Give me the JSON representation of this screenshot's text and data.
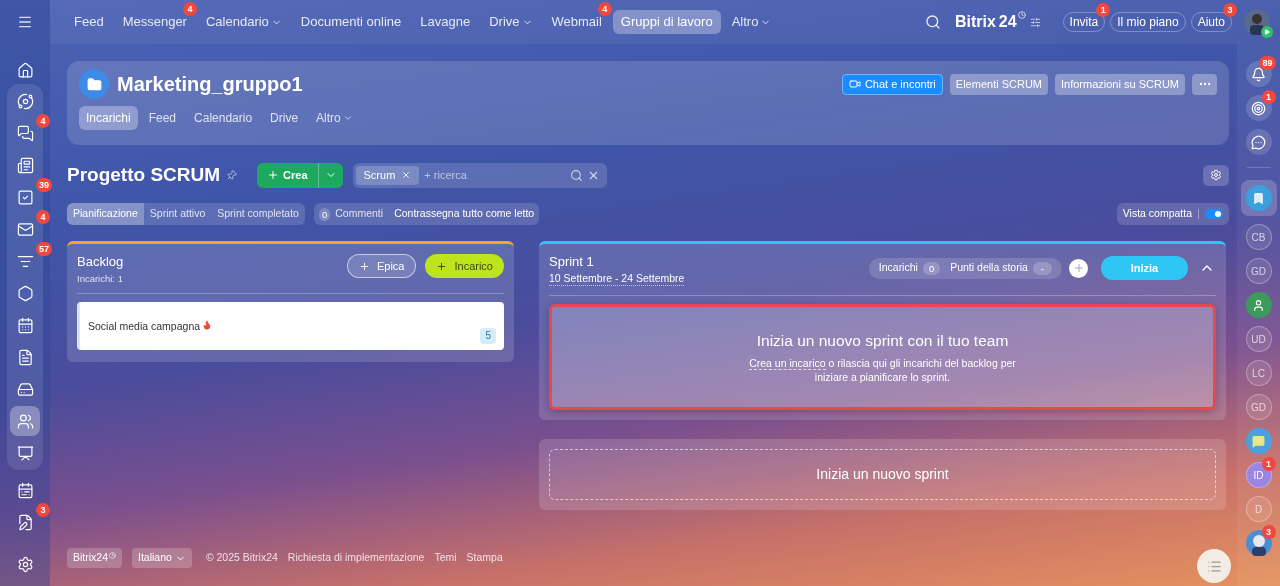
{
  "top_nav": {
    "items": [
      {
        "label": "Feed",
        "dropdown": false,
        "selected": false
      },
      {
        "label": "Messenger",
        "badge": "4",
        "dropdown": false,
        "selected": false
      },
      {
        "label": "Calendario",
        "dropdown": true,
        "selected": false
      },
      {
        "label": "Documenti online",
        "dropdown": false,
        "selected": false
      },
      {
        "label": "Lavagne",
        "dropdown": false,
        "selected": false
      },
      {
        "label": "Drive",
        "dropdown": true,
        "selected": false
      },
      {
        "label": "Webmail",
        "badge": "4",
        "dropdown": false,
        "selected": false
      },
      {
        "label": "Gruppi di lavoro",
        "dropdown": false,
        "selected": true
      },
      {
        "label": "Altro",
        "dropdown": true,
        "selected": false
      }
    ],
    "logo": "Bitrix",
    "logo_number": "24",
    "buttons": [
      {
        "label": "Invita",
        "badge": "1"
      },
      {
        "label": "Il mio piano"
      },
      {
        "label": "Aiuto",
        "badge": "3"
      }
    ]
  },
  "left_sidebar": {
    "items": [
      {
        "selected": false
      },
      {
        "selected": false
      },
      {
        "badge": "4",
        "selected": false
      },
      {
        "selected": false
      },
      {
        "badge": "39",
        "selected": false
      },
      {
        "badge": "4",
        "selected": false
      },
      {
        "badge": "57",
        "selected": false
      },
      {
        "selected": false
      },
      {
        "selected": false
      },
      {
        "selected": false
      },
      {
        "selected": false
      },
      {
        "selected": true
      },
      {
        "selected": false
      },
      {
        "selected": false
      },
      {
        "badge": "3",
        "selected": false
      },
      {
        "selected": false
      }
    ]
  },
  "right_sidebar": {
    "items": [
      {
        "kind": "bell",
        "badge": "89",
        "selected": false
      },
      {
        "kind": "target",
        "badge": "1",
        "selected": false
      },
      {
        "kind": "chat",
        "selected": false
      },
      {
        "kind": "bookmark",
        "selected": true
      },
      {
        "kind": "initials",
        "text": "CB",
        "selected": false
      },
      {
        "kind": "initials",
        "text": "GD",
        "selected": false
      },
      {
        "kind": "card",
        "selected": false
      },
      {
        "kind": "initials",
        "text": "UD",
        "selected": false
      },
      {
        "kind": "initials",
        "text": "LC",
        "selected": false
      },
      {
        "kind": "initials",
        "text": "GD",
        "selected": false
      },
      {
        "kind": "message",
        "selected": false
      },
      {
        "kind": "initials",
        "text": "ID",
        "badge": "1",
        "selected": true
      },
      {
        "kind": "initials",
        "text": "D",
        "selected": false
      },
      {
        "kind": "photo",
        "badge": "3",
        "selected": false
      }
    ]
  },
  "group": {
    "title": "Marketing_gruppo1",
    "buttons": [
      {
        "label": "Chat e incontri",
        "kind": "primary"
      },
      {
        "label": "Elementi SCRUM",
        "kind": "secondary"
      },
      {
        "label": "Informazioni su SCRUM",
        "kind": "secondary"
      }
    ],
    "tabs": [
      {
        "label": "Incarichi",
        "dropdown": false,
        "selected": true
      },
      {
        "label": "Feed",
        "dropdown": false,
        "selected": false
      },
      {
        "label": "Calendario",
        "dropdown": false,
        "selected": false
      },
      {
        "label": "Drive",
        "dropdown": false,
        "selected": false
      },
      {
        "label": "Altro",
        "dropdown": true,
        "selected": false
      }
    ]
  },
  "project": {
    "title": "Progetto SCRUM",
    "create_button": "Crea",
    "filter_tag": "Scrum",
    "search_placeholder": "+ ricerca"
  },
  "view_tabs": [
    {
      "label": "Pianificazione",
      "selected": true
    },
    {
      "label": "Sprint attivo",
      "selected": false
    },
    {
      "label": "Sprint completato",
      "selected": false
    }
  ],
  "comments": {
    "count": "0",
    "label": "Commenti",
    "action": "Contrassegna tutto come letto"
  },
  "compact_view": {
    "label": "Vista compatta",
    "on": true
  },
  "backlog": {
    "title": "Backlog",
    "subtitle": "Incarichi: 1",
    "buttons": [
      "Epica",
      "Incarico"
    ],
    "tasks": [
      {
        "title": "Social media campagna",
        "hot": true,
        "points": "5"
      }
    ]
  },
  "sprint": {
    "title": "Sprint 1",
    "dates": "10 Settembre - 24 Settembre",
    "tasks_label": "Incarichi",
    "tasks_count": "0",
    "points_label": "Punti della storia",
    "points_value": "-",
    "start_button": "Inizia",
    "expanded": true,
    "empty": {
      "title": "Inizia un nuovo sprint con il tuo team",
      "link": "Crea un incarico",
      "text": " o rilascia qui gli incarichi del backlog per iniziare a pianificare lo sprint.",
      "highlighted": true
    }
  },
  "new_sprint": "Inizia un nuovo sprint",
  "footer": {
    "brand": "Bitrix24",
    "language": "Italiano",
    "copyright": "© 2025 Bitrix24",
    "links": [
      "Richiesta di implementazione",
      "Temi",
      "Stampa"
    ]
  }
}
